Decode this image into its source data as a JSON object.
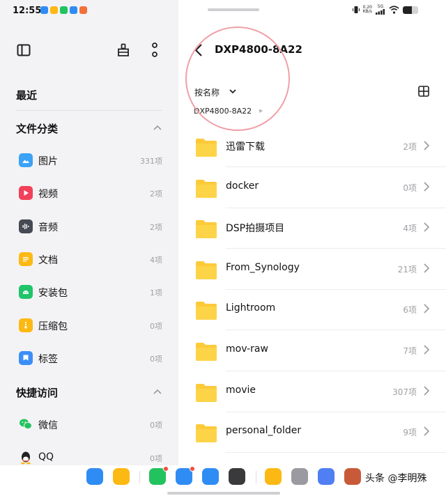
{
  "status_bar": {
    "time": "12:55",
    "net_speed": "0.20",
    "net_unit": "KB/s",
    "signal_label": "5G",
    "battery_level": 0.6
  },
  "left_pane": {
    "recent_heading": "最近",
    "categories_heading": "文件分类",
    "categories": [
      {
        "label": "图片",
        "count": "331项",
        "color": "#3ba2f7",
        "icon": "image-icon"
      },
      {
        "label": "视频",
        "count": "2项",
        "color": "#f2415a",
        "icon": "video-icon"
      },
      {
        "label": "音频",
        "count": "2项",
        "color": "#454a54",
        "icon": "audio-icon"
      },
      {
        "label": "文档",
        "count": "4项",
        "color": "#fdb913",
        "icon": "document-icon"
      },
      {
        "label": "安装包",
        "count": "1项",
        "color": "#20c46a",
        "icon": "android-icon"
      },
      {
        "label": "压缩包",
        "count": "0项",
        "color": "#fdb913",
        "icon": "zip-icon"
      },
      {
        "label": "标签",
        "count": "0项",
        "color": "#3b8ef7",
        "icon": "tag-icon"
      }
    ],
    "quick_access_heading": "快捷访问",
    "quick_access": [
      {
        "label": "微信",
        "count": "0项",
        "color": "#22c35e",
        "icon": "wechat-icon"
      },
      {
        "label": "QQ",
        "count": "0项",
        "color": "#222222",
        "icon": "qq-icon"
      }
    ]
  },
  "right_pane": {
    "title": "DXP4800-8A22",
    "sort_label": "按名称",
    "breadcrumb": "DXP4800-8A22",
    "folders": [
      {
        "name": "迅雷下载",
        "count": "2项"
      },
      {
        "name": "docker",
        "count": "0项"
      },
      {
        "name": "DSP拍摄项目",
        "count": "4项"
      },
      {
        "name": "From_Synology",
        "count": "21项"
      },
      {
        "name": "Lightroom",
        "count": "6项"
      },
      {
        "name": "mov-raw",
        "count": "7项"
      },
      {
        "name": "movie",
        "count": "307项"
      },
      {
        "name": "personal_folder",
        "count": "9项"
      }
    ]
  },
  "dock": {
    "watermark": "头条 @李明殊",
    "apps": [
      {
        "name": "apps-grid-app",
        "color": "#2f8cf4"
      },
      {
        "name": "file-manager-app",
        "color": "#fdb913"
      },
      {
        "name": "phone-app",
        "color": "#22c35e",
        "badge": true
      },
      {
        "name": "messages-app",
        "color": "#2f8cf4",
        "badge": true
      },
      {
        "name": "browser-app",
        "color": "#2f8cf4"
      },
      {
        "name": "camera-app",
        "color": "#3a3a3c"
      },
      {
        "name": "notes-app",
        "color": "#fdb913"
      },
      {
        "name": "settings-app",
        "color": "#9a9aa0"
      },
      {
        "name": "multitask-app",
        "color": "#4f7ff2"
      },
      {
        "name": "game-app",
        "color": "#c85a3a"
      }
    ]
  }
}
